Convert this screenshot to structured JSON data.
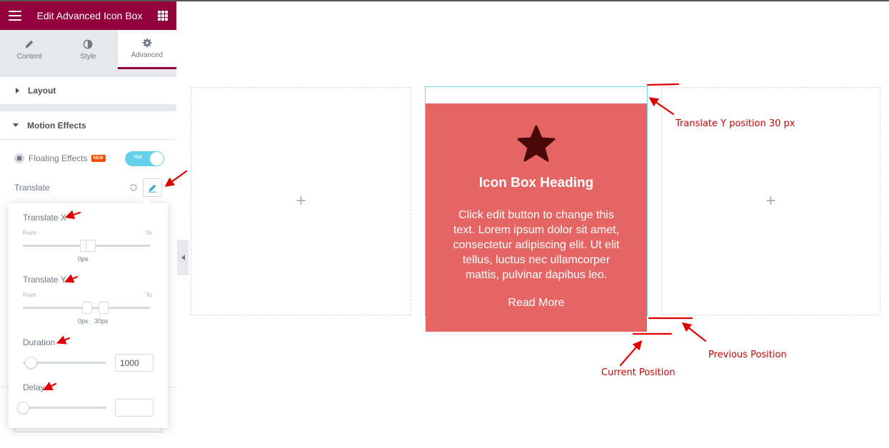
{
  "header": {
    "title": "Edit Advanced Icon Box"
  },
  "tabs": [
    {
      "label": "Content",
      "icon": "pencil-icon"
    },
    {
      "label": "Style",
      "icon": "half-circle-icon"
    },
    {
      "label": "Advanced",
      "icon": "gear-icon",
      "active": true
    }
  ],
  "sections": {
    "layout": {
      "label": "Layout"
    },
    "motion": {
      "label": "Motion Effects",
      "floating": {
        "label": "Floating Effects",
        "badge": "NEW",
        "toggle": "YES"
      },
      "translate": {
        "label": "Translate"
      }
    }
  },
  "popover": {
    "translate_x": {
      "label": "Translate X",
      "from": "From",
      "to": "To",
      "value": "0px"
    },
    "translate_y": {
      "label": "Translate Y",
      "from": "From",
      "to": "To",
      "value_from": "0px",
      "value_to": "30px"
    },
    "duration": {
      "label": "Duration",
      "value": "1000"
    },
    "delay": {
      "label": "Delay",
      "value": ""
    }
  },
  "canvas": {
    "add_symbol": "+",
    "icon_box": {
      "heading": "Icon Box Heading",
      "text": "Click edit button to change this text. Lorem ipsum dolor sit amet, consectetur adipiscing elit. Ut elit tellus, luctus nec ullamcorper mattis, pulvinar dapibus leo.",
      "link": "Read More",
      "bg_color": "#e46563",
      "icon": "star-icon"
    }
  },
  "annotations": {
    "translate_y_note": "Translate Y position 30 px",
    "previous_position": "Previous Position",
    "current_position": "Current Position"
  },
  "colors": {
    "brand": "#93003c",
    "toggle": "#63d0ea",
    "annotation": "#e00000"
  }
}
